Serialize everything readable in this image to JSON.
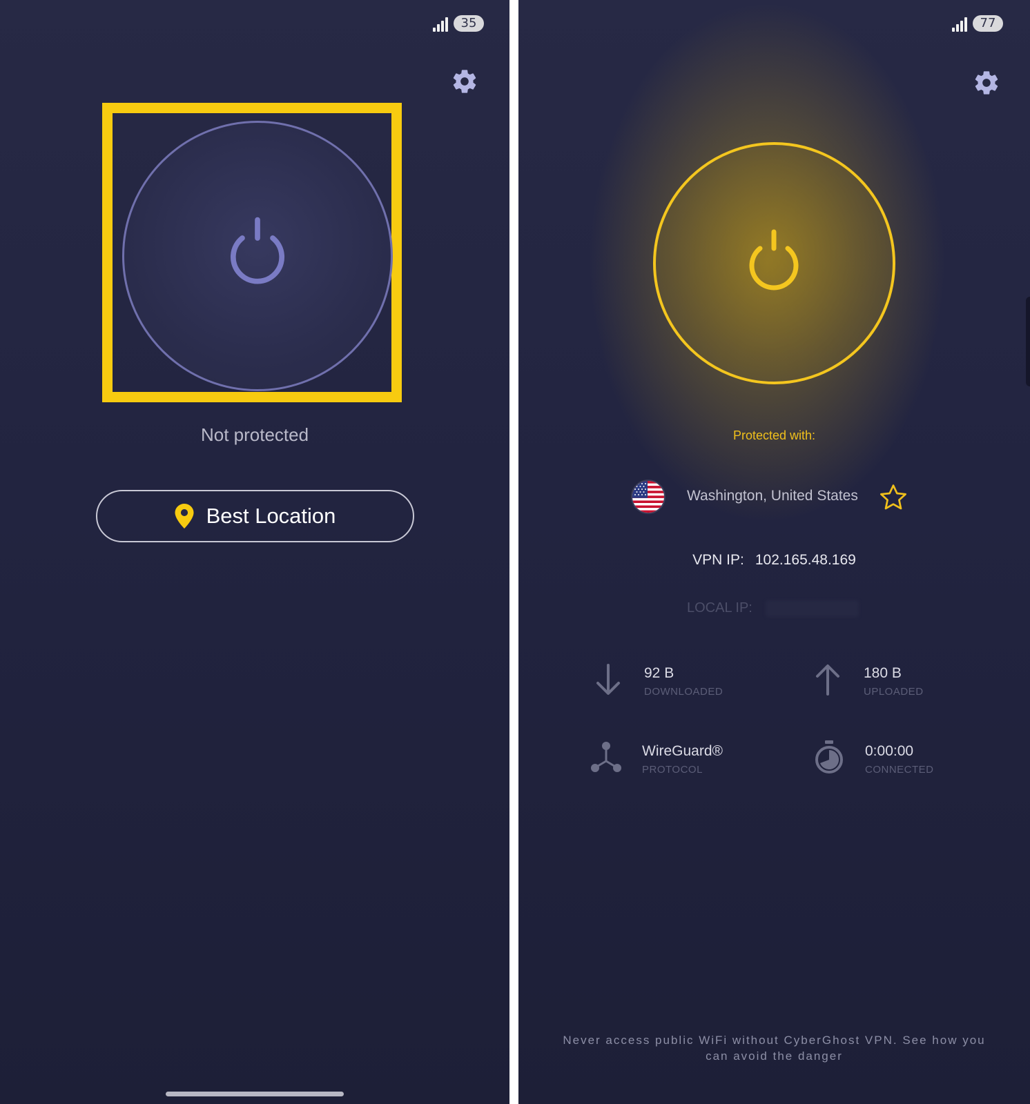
{
  "left_screen": {
    "status_bar": {
      "battery": "35"
    },
    "settings_icon": "gear-icon",
    "power_icon": "power-icon",
    "status": "Not protected",
    "location_button": {
      "icon": "map-pin-icon",
      "label": "Best Location"
    }
  },
  "right_screen": {
    "status_bar": {
      "battery": "77"
    },
    "settings_icon": "gear-icon",
    "power_icon": "power-icon",
    "protected_label": "Protected with:",
    "location": {
      "flag": "us-flag-icon",
      "name": "Washington, United States",
      "favorite_icon": "star-icon"
    },
    "vpn_ip": {
      "label": "VPN IP:",
      "value": "102.165.48.169"
    },
    "local_ip": {
      "label": "LOCAL IP:"
    },
    "stats": {
      "downloaded": {
        "value": "92 B",
        "caption": "DOWNLOADED",
        "icon": "arrow-down-icon"
      },
      "uploaded": {
        "value": "180 B",
        "caption": "UPLOADED",
        "icon": "arrow-up-icon"
      },
      "protocol": {
        "value": "WireGuard®",
        "caption": "PROTOCOL",
        "icon": "network-nodes-icon"
      },
      "connected": {
        "value": "0:00:00",
        "caption": "CONNECTED",
        "icon": "timer-icon"
      }
    },
    "footer_note": "Never access public WiFi without CyberGhost VPN. See how you can avoid the danger"
  },
  "colors": {
    "accent_yellow": "#f7cb10",
    "ring_inactive": "#7070ad",
    "background": "#23253f"
  }
}
